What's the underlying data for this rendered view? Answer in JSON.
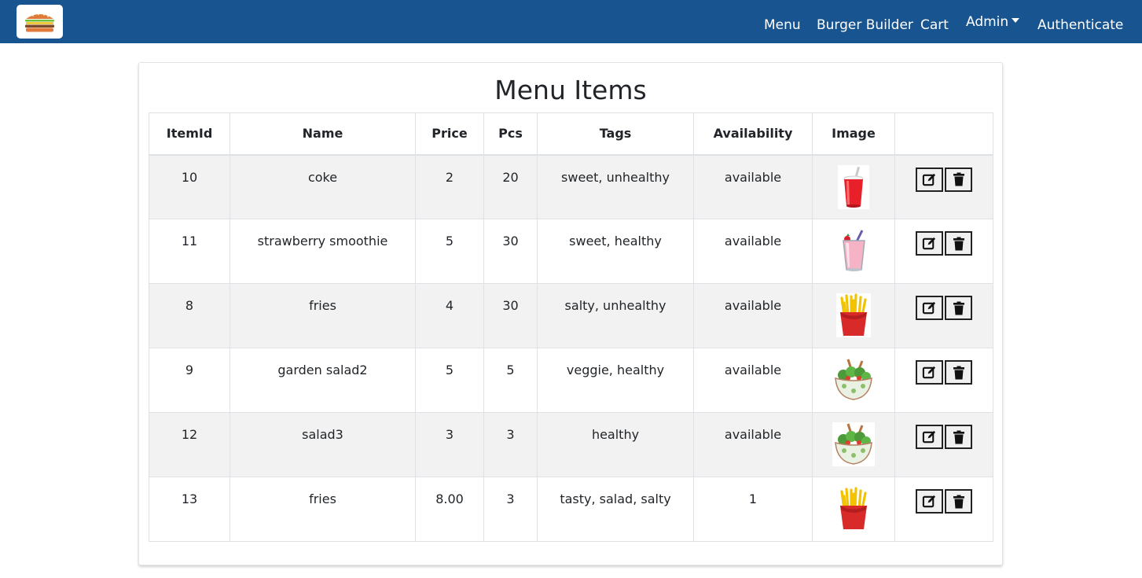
{
  "navbar": {
    "logo_icon": "burger-icon",
    "links": [
      "Menu",
      "Burger Builder",
      "Cart",
      "Admin",
      "Authenticate"
    ],
    "color": "#175490"
  },
  "page": {
    "title": "Menu Items"
  },
  "table": {
    "headers": [
      "ItemId",
      "Name",
      "Price",
      "Pcs",
      "Tags",
      "Availability",
      "Image",
      ""
    ],
    "rows": [
      {
        "id": "10",
        "name": "coke",
        "price": "2",
        "pcs": "20",
        "tags": "sweet, unhealthy",
        "availability": "available",
        "image": "soda-cup-icon"
      },
      {
        "id": "11",
        "name": "strawberry smoothie",
        "price": "5",
        "pcs": "30",
        "tags": "sweet, healthy",
        "availability": "available",
        "image": "smoothie-glass-icon"
      },
      {
        "id": "8",
        "name": "fries",
        "price": "4",
        "pcs": "30",
        "tags": "salty, unhealthy",
        "availability": "available",
        "image": "fries-icon"
      },
      {
        "id": "9",
        "name": "garden salad2",
        "price": "5",
        "pcs": "5",
        "tags": "veggie, healthy",
        "availability": "available",
        "image": "salad-bowl-icon"
      },
      {
        "id": "12",
        "name": "salad3",
        "price": "3",
        "pcs": "3",
        "tags": "healthy",
        "availability": "available",
        "image": "salad-bowl-icon"
      },
      {
        "id": "13",
        "name": "fries",
        "price": "8.00",
        "pcs": "3",
        "tags": "tasty, salad, salty",
        "availability": "1",
        "image": "fries-icon"
      }
    ],
    "actions": {
      "edit_icon": "edit-icon",
      "delete_icon": "trash-icon"
    }
  }
}
